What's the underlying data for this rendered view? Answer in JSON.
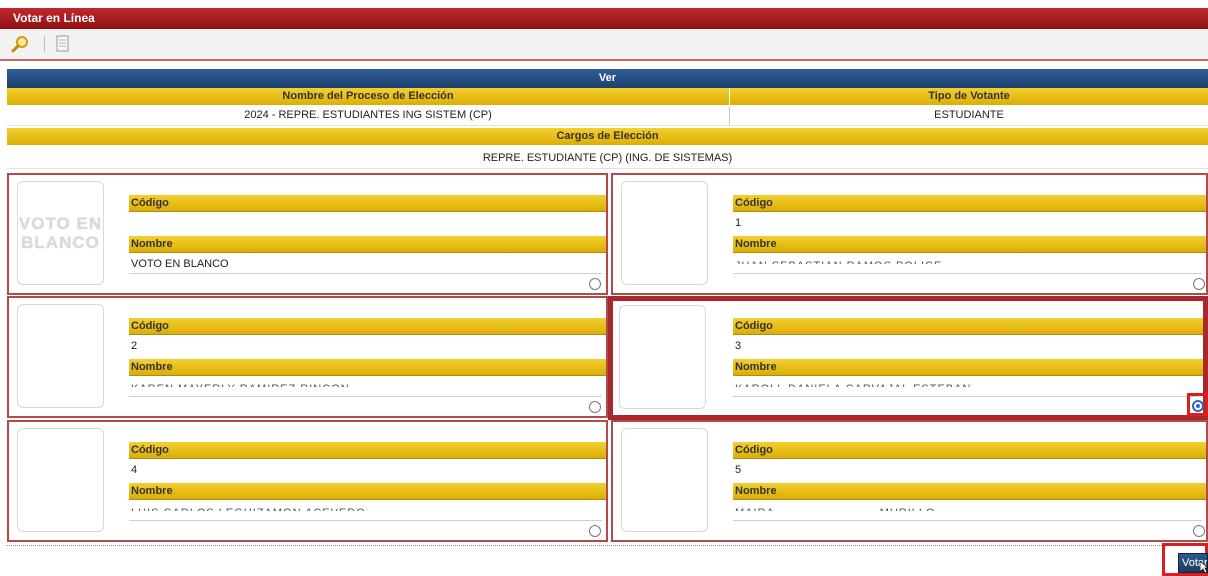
{
  "window": {
    "title": "Votar en Línea"
  },
  "toolbar": {
    "search_icon": "search-icon",
    "document_icon": "document-icon"
  },
  "section": {
    "header": "Ver"
  },
  "process": {
    "name_header": "Nombre del Proceso de Elección",
    "name_value": "2024 - REPRE. ESTUDIANTES ING SISTEM (CP)",
    "voter_type_header": "Tipo de Votante",
    "voter_type_value": "ESTUDIANTE"
  },
  "positions": {
    "header": "Cargos de Elección",
    "value": "REPRE. ESTUDIANTE (CP) (ING. DE SISTEMAS)"
  },
  "labels": {
    "code": "Código",
    "name": "Nombre"
  },
  "candidates": [
    {
      "photo_text": "VOTO EN BLANCO",
      "code": "",
      "name": "VOTO EN BLANCO",
      "selected": false
    },
    {
      "photo_text": "",
      "code": "1",
      "name": "JUAN SEBASTIAN RAMOS POLICE",
      "selected": false
    },
    {
      "photo_text": "",
      "code": "2",
      "name": "KAREN MAYERLY RAMIREZ RINCON",
      "selected": false
    },
    {
      "photo_text": "",
      "code": "3",
      "name": "KAROLL DANIELA CARVAJAL ESTEBAN",
      "selected": true
    },
    {
      "photo_text": "",
      "code": "4",
      "name": "LUIS CARLOS LEGUIZAMON ACEVEDO",
      "selected": false
    },
    {
      "photo_text": "",
      "code": "5",
      "name": "MAIRA                          MURILLO",
      "selected": false
    }
  ],
  "actions": {
    "vote_label": "Votar"
  },
  "colors": {
    "title_red": "#a8171b",
    "header_blue": "#1f4472",
    "gold": "#e8bd12",
    "selection_red": "#d81e1e",
    "radio_blue": "#2a64c5"
  }
}
